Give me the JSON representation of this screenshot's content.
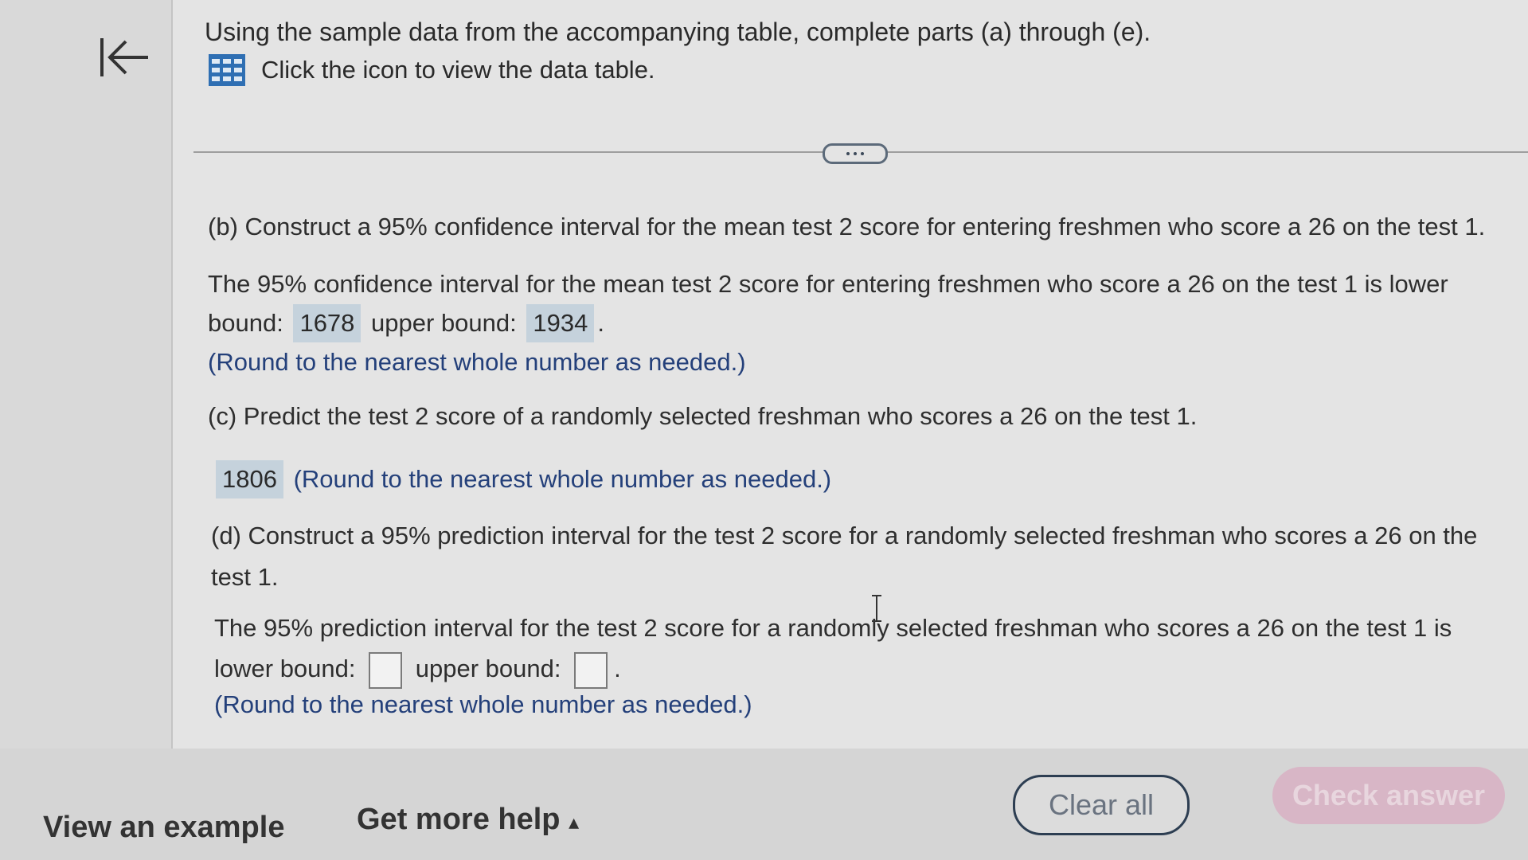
{
  "header": {
    "back_icon": "back-to-start-icon",
    "intro": "Using the sample data from the accompanying table, complete parts (a) through (e).",
    "table_link": "Click the icon to view the data table.",
    "table_icon": "grid-table-icon"
  },
  "partB": {
    "question": "(b) Construct a 95% confidence interval for the mean test 2 score for entering freshmen who score a 26 on the test 1.",
    "answer_line1": "The 95% confidence interval for the mean test 2 score for entering freshmen who score a 26 on the test 1 is lower",
    "lower_prefix": "bound:",
    "lower_value": "1678",
    "upper_label": "upper bound:",
    "upper_value": "1934",
    "period": ".",
    "note": "(Round to the nearest whole number as needed.)"
  },
  "partC": {
    "question": "(c) Predict the test 2 score of a randomly selected freshman who scores a 26 on the test 1.",
    "value": "1806",
    "note": "(Round to the nearest whole number as needed.)"
  },
  "partD": {
    "question_line1": "(d) Construct a 95% prediction interval for the test 2 score for a randomly selected freshman who scores a 26 on the",
    "question_line2": "test 1.",
    "answer_line1": "The 95% prediction interval for the test 2 score for a randomly selected freshman who scores a 26 on the test 1 is",
    "lower_label": "lower bound:",
    "upper_label": "upper bound:",
    "lower_value": "",
    "upper_value": "",
    "period": ".",
    "note": "(Round to the nearest whole number as needed.)"
  },
  "footer": {
    "view_example": "View an example",
    "get_help": "Get more help",
    "help_arrow": "▴",
    "clear_all": "Clear all",
    "check_answer": "Check answer"
  },
  "colors": {
    "answer_highlight": "#c5d2dc",
    "note_blue": "#24407a",
    "check_button": "#d8b6c6"
  }
}
